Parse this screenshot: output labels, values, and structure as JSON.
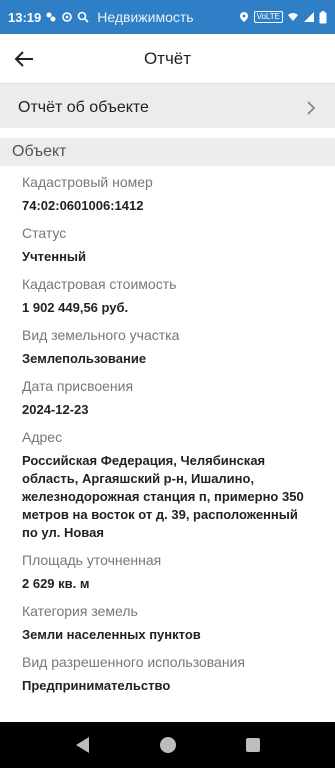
{
  "status_bar": {
    "time": "13:19",
    "app_name": "Недвижимость",
    "network": "VoLTE",
    "icons": [
      "app-logo-icon",
      "gear-icon",
      "notification-icon",
      "search-icon",
      "location-icon",
      "wifi-icon",
      "signal-icon",
      "battery-icon"
    ]
  },
  "header": {
    "title": "Отчёт",
    "back_icon": "arrow-left-icon"
  },
  "report_link": {
    "label": "Отчёт об объекте"
  },
  "section": {
    "title": "Объект"
  },
  "fields": [
    {
      "label": "Кадастровый номер",
      "value": "74:02:0601006:1412"
    },
    {
      "label": "Статус",
      "value": "Учтенный"
    },
    {
      "label": "Кадастровая стоимость",
      "value": "1 902 449,56 руб."
    },
    {
      "label": "Вид земельного участка",
      "value": "Землепользование"
    },
    {
      "label": "Дата присвоения",
      "value": "2024-12-23"
    },
    {
      "label": "Адрес",
      "value": "Российская Федерация, Челябинская область, Аргаяшский р-н, Ишалино, железнодорожная станция п, примерно 350 метров на восток от д. 39, расположенный по ул. Новая"
    },
    {
      "label": "Площадь уточненная",
      "value": "2 629 кв. м"
    },
    {
      "label": "Категория земель",
      "value": "Земли населенных пунктов"
    },
    {
      "label": "Вид разрешенного использования",
      "value": "Предпринимательство"
    }
  ],
  "colors": {
    "status_bar": "#2f7fc6",
    "section_bg": "#ececec",
    "label": "#777777",
    "value": "#222222"
  }
}
